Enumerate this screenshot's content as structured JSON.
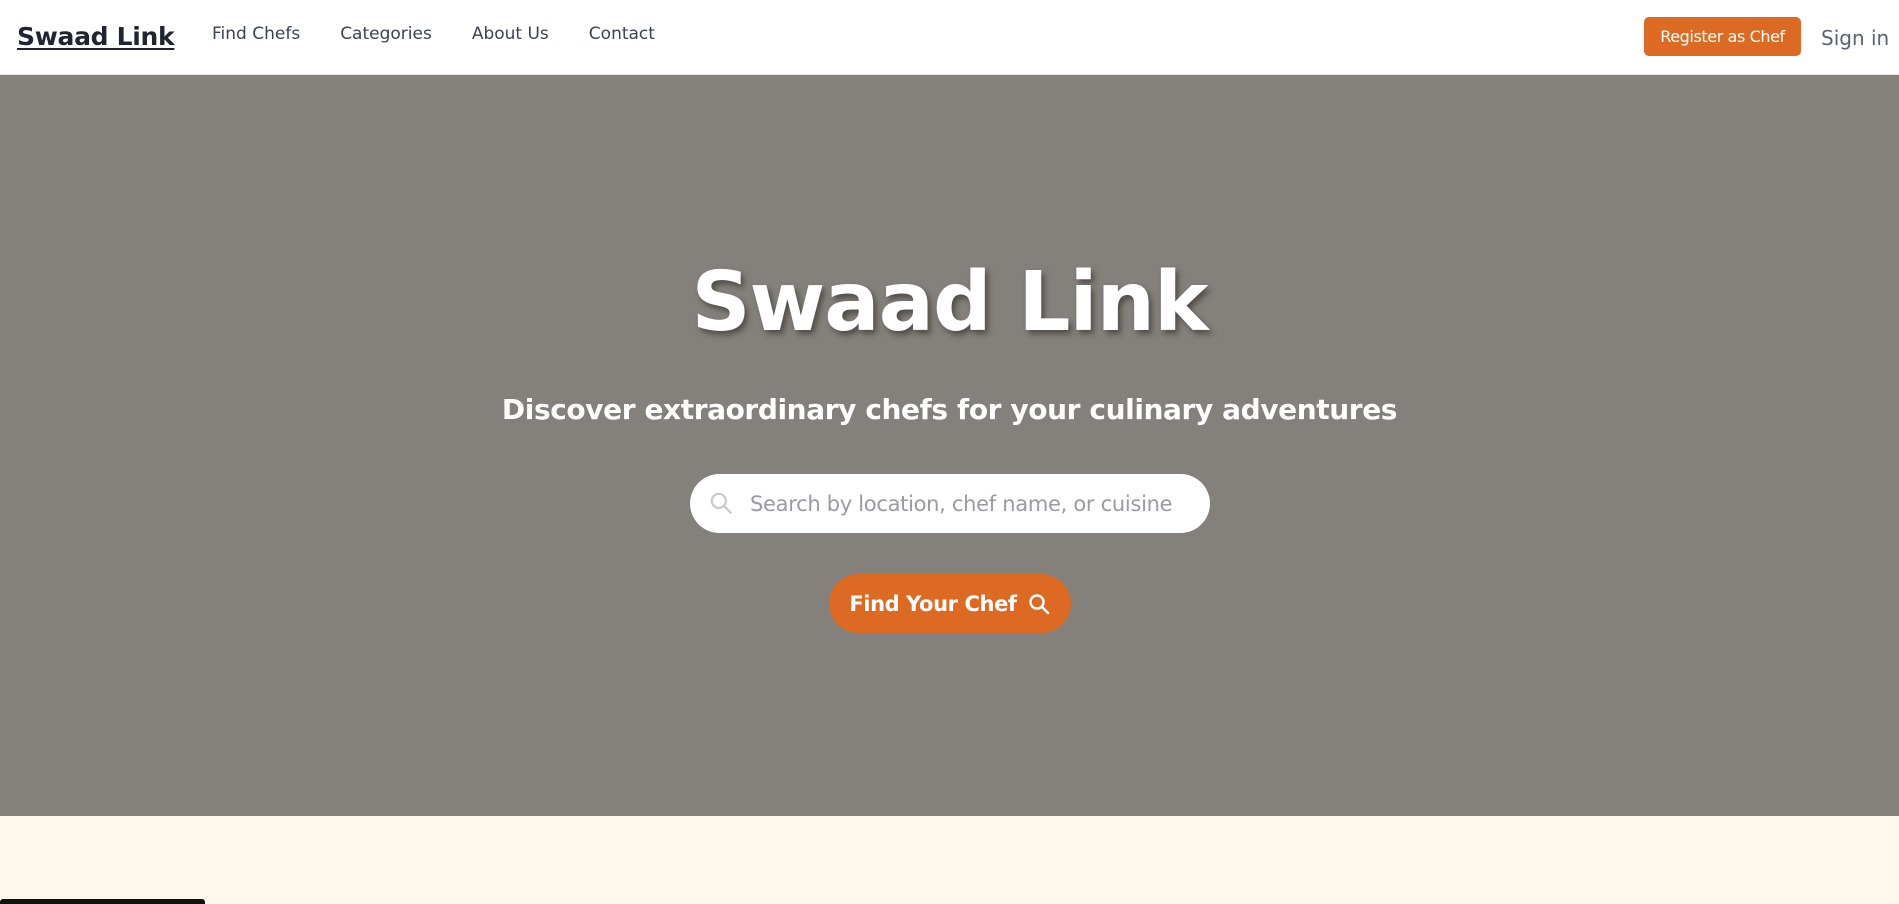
{
  "navbar": {
    "brand": "Swaad Link",
    "links": [
      "Find Chefs",
      "Categories",
      "About Us",
      "Contact"
    ],
    "register_label": "Register as Chef",
    "signin_label": "Sign in"
  },
  "hero": {
    "title": "Swaad Link",
    "subtitle": "Discover extraordinary chefs for your culinary adventures",
    "search_placeholder": "Search by location, chef name, or cuisine",
    "search_value": "",
    "cta_label": "Find Your Chef"
  },
  "colors": {
    "accent": "#dd6a23",
    "hero_bg": "#84807b",
    "page_bg": "#fdf8ec",
    "nav_text": "#3b4250"
  },
  "icons": {
    "search_field": "search-icon",
    "cta": "search-icon"
  }
}
